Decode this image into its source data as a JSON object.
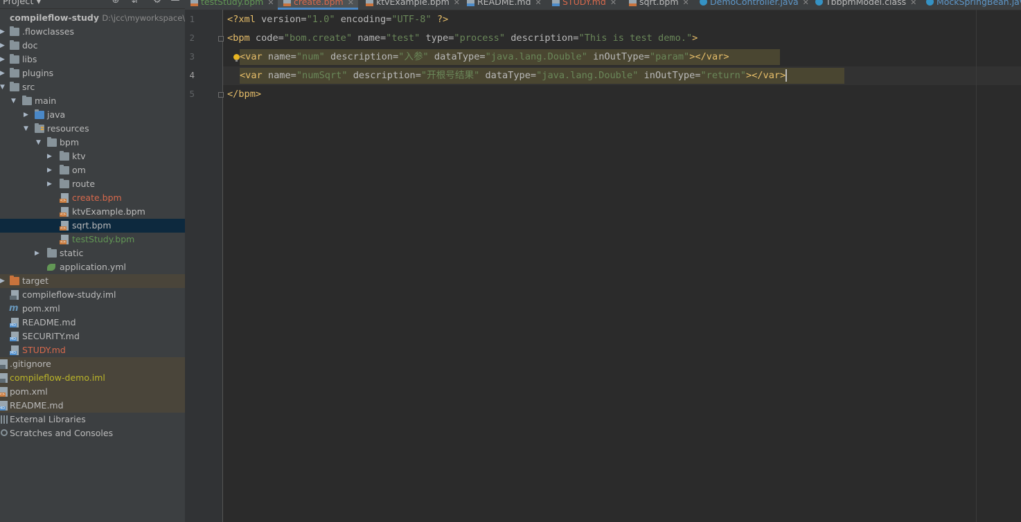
{
  "project": {
    "title": "Project",
    "tree": [
      {
        "name": "compileflow-study",
        "path": "D:\\jcc\\myworkspace\\cc",
        "kind": "root"
      },
      {
        "name": ".flowclasses",
        "kind": "folder"
      },
      {
        "name": "doc",
        "kind": "folder"
      },
      {
        "name": "libs",
        "kind": "folder"
      },
      {
        "name": "plugins",
        "kind": "folder"
      },
      {
        "name": "src",
        "kind": "folder"
      },
      {
        "name": "main",
        "kind": "folder"
      },
      {
        "name": "java",
        "kind": "folder"
      },
      {
        "name": "resources",
        "kind": "folder"
      },
      {
        "name": "bpm",
        "kind": "folder"
      },
      {
        "name": "ktv",
        "kind": "folder"
      },
      {
        "name": "om",
        "kind": "folder"
      },
      {
        "name": "route",
        "kind": "folder"
      },
      {
        "name": "create.bpm",
        "kind": "bpm"
      },
      {
        "name": "ktvExample.bpm",
        "kind": "bpm"
      },
      {
        "name": "sqrt.bpm",
        "kind": "bpm"
      },
      {
        "name": "testStudy.bpm",
        "kind": "bpm"
      },
      {
        "name": "static",
        "kind": "folder"
      },
      {
        "name": "application.yml",
        "kind": "yml"
      },
      {
        "name": "target",
        "kind": "folder"
      },
      {
        "name": "compileflow-study.iml",
        "kind": "iml"
      },
      {
        "name": "pom.xml",
        "kind": "maven"
      },
      {
        "name": "README.md",
        "kind": "md"
      },
      {
        "name": "SECURITY.md",
        "kind": "md"
      },
      {
        "name": "STUDY.md",
        "kind": "md"
      },
      {
        "name": ".gitignore",
        "kind": "file"
      },
      {
        "name": "compileflow-demo.iml",
        "kind": "iml"
      },
      {
        "name": "pom.xml",
        "kind": "xml"
      },
      {
        "name": "README.md",
        "kind": "md"
      },
      {
        "name": "External Libraries",
        "kind": "lib"
      },
      {
        "name": "Scratches and Consoles",
        "kind": "scratch"
      }
    ]
  },
  "tabs": [
    {
      "label": "testStudy.bpm",
      "icon": "bpm-file-icon"
    },
    {
      "label": "create.bpm",
      "icon": "bpm-file-icon",
      "active": true
    },
    {
      "label": "ktvExample.bpm",
      "icon": "bpm-file-icon"
    },
    {
      "label": "README.md",
      "icon": "md-file-icon"
    },
    {
      "label": "STUDY.md",
      "icon": "md-file-icon"
    },
    {
      "label": "sqrt.bpm",
      "icon": "bpm-file-icon"
    },
    {
      "label": "DemoController.java",
      "icon": "java-class-icon"
    },
    {
      "label": "TbbpmModel.class",
      "icon": "java-class-icon"
    },
    {
      "label": "MockSpringBean.jav",
      "icon": "java-class-icon"
    }
  ],
  "editor": {
    "line_numbers": [
      "1",
      "2",
      "3",
      "4",
      "5"
    ],
    "lines": {
      "l1": {
        "pi_open": "<?xml ",
        "a1": "version=",
        "v1": "\"1.0\"",
        "a2": " encoding=",
        "v2": "\"UTF-8\"",
        "pi_close": " ?>"
      },
      "l2": {
        "open": "<bpm ",
        "a1": "code=",
        "v1": "\"bom.create\"",
        "a2": " name=",
        "v2": "\"test\"",
        "a3": " type=",
        "v3": "\"process\"",
        "a4": " description=",
        "v4": "\"This is test demo.\"",
        "close": ">"
      },
      "l3": {
        "open": "<var ",
        "a1": "name=",
        "v1": "\"num\"",
        "a2": " description=",
        "v2": "\"入参\"",
        "a3": " dataType=",
        "v3": "\"java.lang.Double\"",
        "a4": " inOutType=",
        "v4": "\"param\"",
        "close": "></var>"
      },
      "l4": {
        "open": "<var ",
        "a1": "name=",
        "v1": "\"numSqrt\"",
        "a2": " description=",
        "v2": "\"开根号结果\"",
        "a3": " dataType=",
        "v3": "\"java.lang.Double\"",
        "a4": " inOutType=",
        "v4": "\"return\"",
        "close": "></var>"
      },
      "l5": {
        "close": "</bpm>"
      }
    }
  },
  "colors": {
    "tag": "#e8bf6a",
    "attr": "#bababa",
    "value": "#6a8759",
    "background": "#2b2b2b",
    "accent": "#4a88c7"
  }
}
